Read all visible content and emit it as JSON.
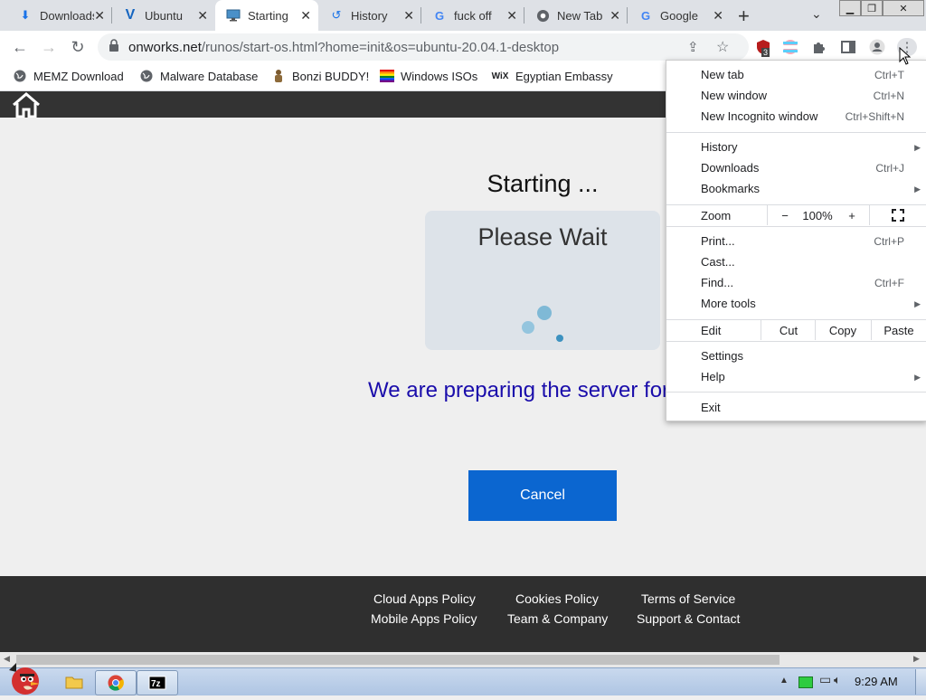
{
  "tabs": [
    {
      "icon": "download-icon",
      "label": "Downloads"
    },
    {
      "icon": "ubuntu-v-icon",
      "label": "Ubuntu"
    },
    {
      "icon": "monitor-icon",
      "label": "Starting"
    },
    {
      "icon": "history-icon",
      "label": "History"
    },
    {
      "icon": "google-g-icon",
      "label": "fuck off"
    },
    {
      "icon": "chrome-icon",
      "label": "New Tab"
    },
    {
      "icon": "google-g-icon",
      "label": "Google"
    }
  ],
  "address": {
    "host": "onworks.net",
    "path": "/runos/start-os.html?home=init&os=ubuntu-20.04.1-desktop"
  },
  "extension_badge": "3",
  "bookmarks": [
    {
      "icon": "globe-icon",
      "label": "MEMZ Download"
    },
    {
      "icon": "globe-icon",
      "label": "Malware Database"
    },
    {
      "icon": "bonzi-icon",
      "label": "Bonzi BUDDY!"
    },
    {
      "icon": "rainbow-flag-icon",
      "label": "Windows ISOs"
    },
    {
      "icon": "wix-icon",
      "label": "Egyptian Embassy"
    }
  ],
  "page": {
    "starting": "Starting ...",
    "please_wait": "Please Wait",
    "preparing": "We are preparing the server for",
    "cancel": "Cancel"
  },
  "footer": {
    "col1": [
      "Cloud Apps Policy",
      "Mobile Apps Policy"
    ],
    "col2": [
      "Cookies Policy",
      "Team & Company"
    ],
    "col3": [
      "Terms of Service",
      "Support & Contact"
    ]
  },
  "menu": {
    "new_tab": "New tab",
    "new_tab_sc": "Ctrl+T",
    "new_window": "New window",
    "new_window_sc": "Ctrl+N",
    "incognito": "New Incognito window",
    "incognito_sc": "Ctrl+Shift+N",
    "history": "History",
    "downloads": "Downloads",
    "downloads_sc": "Ctrl+J",
    "bookmarks": "Bookmarks",
    "zoom": "Zoom",
    "zoom_minus": "−",
    "zoom_value": "100%",
    "zoom_plus": "+",
    "print": "Print...",
    "print_sc": "Ctrl+P",
    "cast": "Cast...",
    "find": "Find...",
    "find_sc": "Ctrl+F",
    "more_tools": "More tools",
    "edit": "Edit",
    "cut": "Cut",
    "copy": "Copy",
    "paste": "Paste",
    "settings": "Settings",
    "help": "Help",
    "exit": "Exit"
  },
  "taskbar": {
    "clock": "9:29 AM"
  },
  "colors": {
    "accent": "#0b66d0",
    "link": "#1a0dab",
    "footer": "#2f2f2f"
  }
}
